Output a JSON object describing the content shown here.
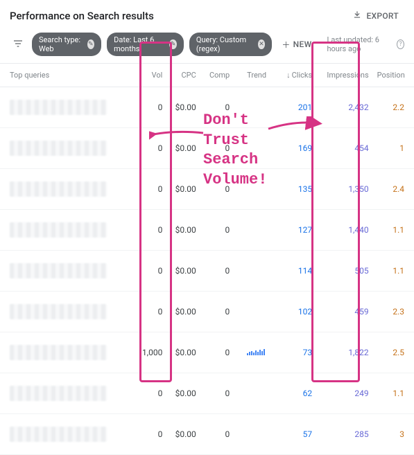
{
  "header": {
    "title": "Performance on Search results",
    "export_label": "EXPORT"
  },
  "filters": {
    "chip_type": "Search type: Web",
    "chip_date": "Date: Last 6 months",
    "chip_query": "Query: Custom (regex)",
    "new_label": "NEW",
    "last_updated": "Last updated: 6 hours ago"
  },
  "columns": {
    "query": "Top queries",
    "vol": "Vol",
    "cpc": "CPC",
    "comp": "Comp",
    "trend": "Trend",
    "clicks": "Clicks",
    "impressions": "Impressions",
    "position": "Position"
  },
  "rows": [
    {
      "vol": "0",
      "cpc": "$0.00",
      "comp": "0",
      "trend": "",
      "clicks": "201",
      "impressions": "2,432",
      "position": "2.2"
    },
    {
      "vol": "0",
      "cpc": "$0.00",
      "comp": "0",
      "trend": "",
      "clicks": "169",
      "impressions": "454",
      "position": "1"
    },
    {
      "vol": "0",
      "cpc": "$0.00",
      "comp": "0",
      "trend": "",
      "clicks": "135",
      "impressions": "1,350",
      "position": "2.4"
    },
    {
      "vol": "0",
      "cpc": "$0.00",
      "comp": "0",
      "trend": "",
      "clicks": "127",
      "impressions": "1,440",
      "position": "1.1"
    },
    {
      "vol": "0",
      "cpc": "$0.00",
      "comp": "0",
      "trend": "",
      "clicks": "114",
      "impressions": "505",
      "position": "1.1"
    },
    {
      "vol": "0",
      "cpc": "$0.00",
      "comp": "0",
      "trend": "",
      "clicks": "102",
      "impressions": "459",
      "position": "2.3"
    },
    {
      "vol": "1,000",
      "cpc": "$0.00",
      "comp": "0",
      "trend": "spark",
      "clicks": "73",
      "impressions": "1,822",
      "position": "2.5"
    },
    {
      "vol": "0",
      "cpc": "$0.00",
      "comp": "0",
      "trend": "",
      "clicks": "62",
      "impressions": "249",
      "position": "1.1"
    },
    {
      "vol": "0",
      "cpc": "$0.00",
      "comp": "0",
      "trend": "",
      "clicks": "57",
      "impressions": "285",
      "position": "3"
    }
  ],
  "annotation": {
    "text": "Don't Trust Search Volume!"
  }
}
